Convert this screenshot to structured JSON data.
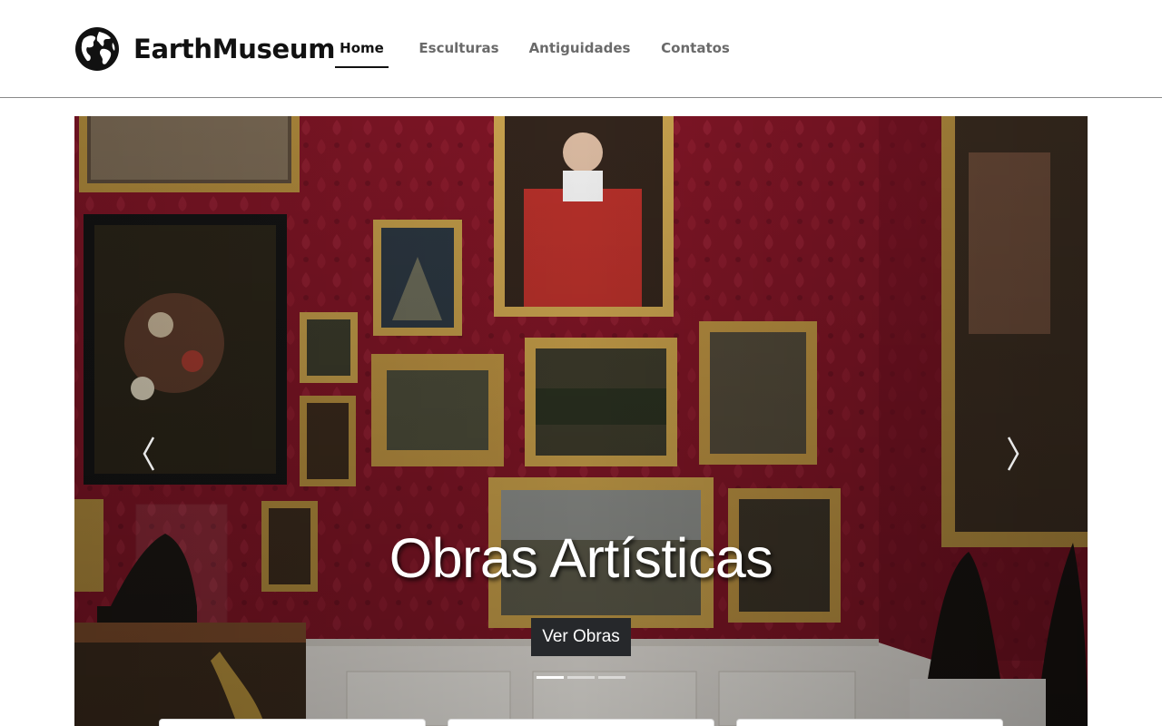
{
  "header": {
    "brand_name": "EarthMuseum",
    "logo_icon": "globe-icon",
    "nav": [
      {
        "label": "Home",
        "active": true
      },
      {
        "label": "Esculturas",
        "active": false
      },
      {
        "label": "Antiguidades",
        "active": false
      },
      {
        "label": "Contatos",
        "active": false
      }
    ]
  },
  "carousel": {
    "slide_title": "Obras Artísticas",
    "button_label": "Ver Obras",
    "prev_icon": "chevron-left-icon",
    "next_icon": "chevron-right-icon",
    "slide_count": 3,
    "active_slide": 1
  },
  "colors": {
    "wall": "#7e1525",
    "button": "#26282b",
    "accent": "#111111"
  }
}
